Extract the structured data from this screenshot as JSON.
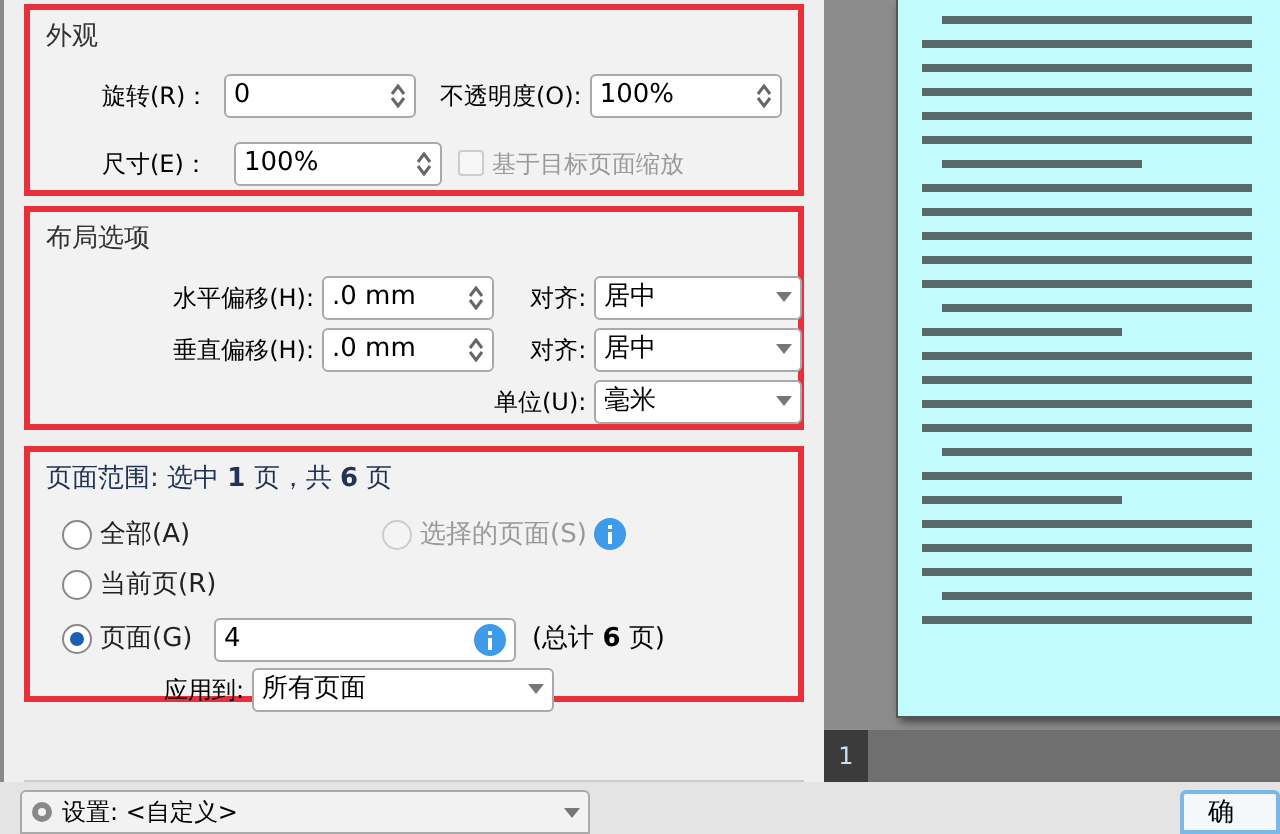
{
  "appearance": {
    "title": "外观",
    "rotation": {
      "label": "旋转(R)：",
      "value": "0"
    },
    "opacity": {
      "label": "不透明度(O):",
      "value": "100%"
    },
    "size": {
      "label": "尺寸(E)：",
      "value": "100%"
    },
    "fit_checkbox": {
      "label": "基于目标页面缩放",
      "checked": false,
      "disabled": true
    }
  },
  "layout": {
    "title": "布局选项",
    "offsets": [
      {
        "label": "水平偏移(H):",
        "value": ".0 mm"
      },
      {
        "label": "垂直偏移(H):",
        "value": ".0 mm"
      }
    ],
    "selects": [
      {
        "label": "对齐:",
        "value": "居中"
      },
      {
        "label": "对齐:",
        "value": "居中"
      },
      {
        "label": "单位(U):",
        "value": "毫米"
      }
    ]
  },
  "page_range": {
    "title": "页面范围: 选中 **1** 页，共 **6** 页",
    "radios": [
      {
        "label": "全部(A)",
        "selected": false,
        "disabled": false,
        "info": false
      },
      {
        "label": "选择的页面(S)",
        "selected": false,
        "disabled": true,
        "info": true
      },
      {
        "label": "当前页(R)",
        "selected": false,
        "disabled": false,
        "info": false
      },
      {
        "label": "页面(G)",
        "selected": true,
        "disabled": false,
        "info": false
      }
    ],
    "pages_value": "4",
    "total": "(总计 **6** 页)",
    "apply_to": {
      "label": "应用到:",
      "value": "所有页面"
    }
  },
  "preview": {
    "page_number": "1"
  },
  "settings": {
    "label": "设置: <自定义>"
  },
  "ok_button": "确"
}
